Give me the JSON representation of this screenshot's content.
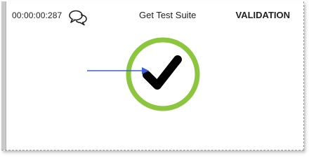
{
  "card": {
    "timer": "00:00:00:287",
    "comment_icon": "chat-bubbles-icon",
    "title": "Get Test Suite",
    "status": "VALIDATION"
  },
  "result": {
    "icon": "check-circle-icon",
    "ring_color": "#8cc63f",
    "check_color": "#000000"
  },
  "annotation": {
    "icon": "arrow-right-icon",
    "color": "#3d5fd8"
  }
}
